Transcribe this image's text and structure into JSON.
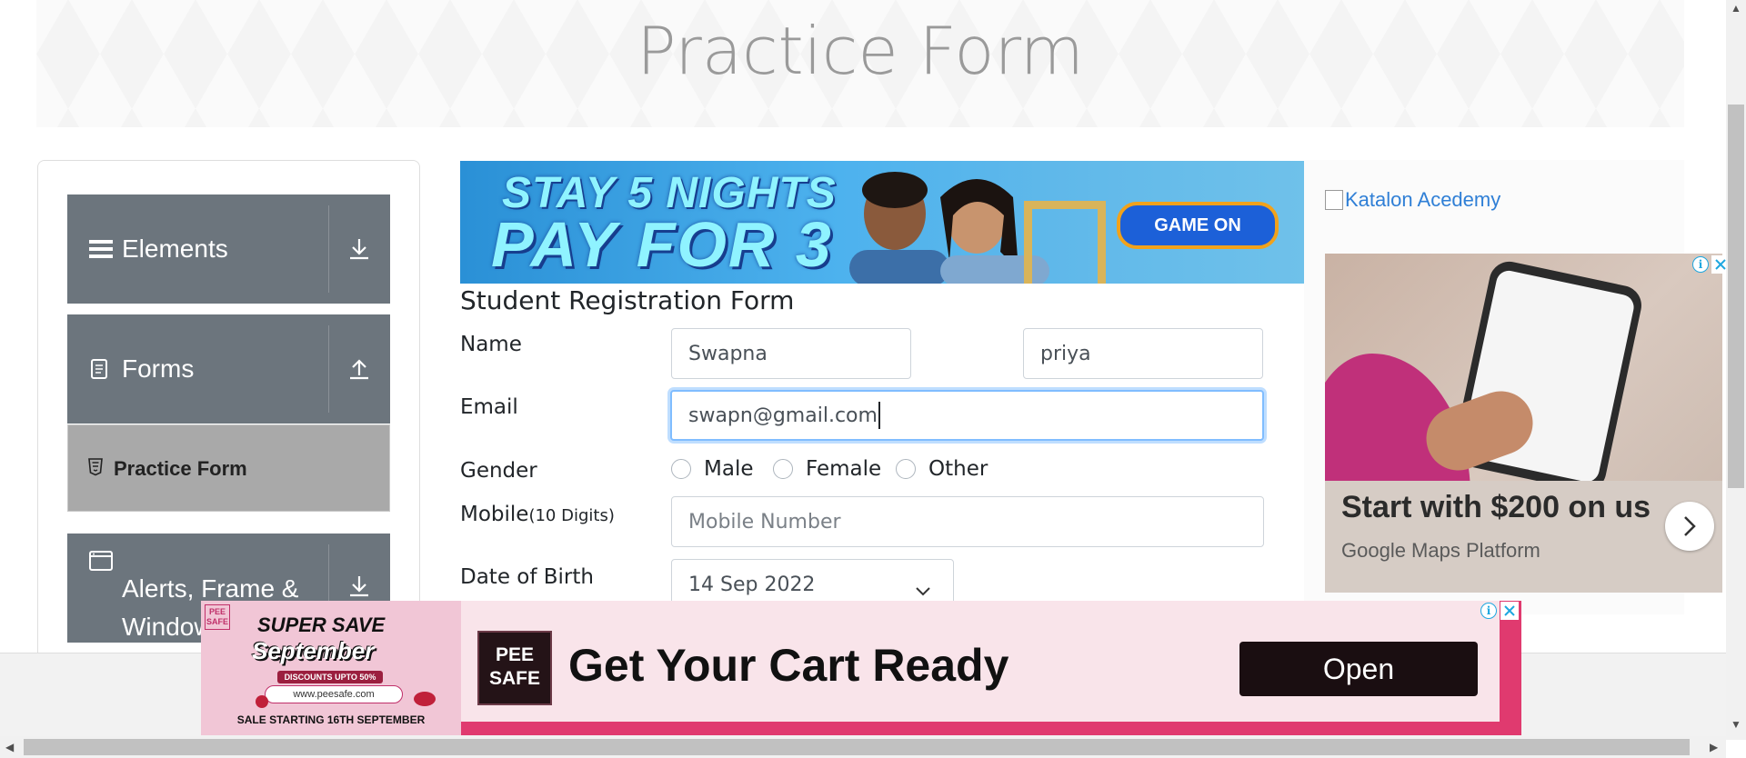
{
  "header": {
    "title": "Practice Form"
  },
  "sidebar": {
    "groups": [
      {
        "label": "Elements",
        "icon": "hamburger-icon",
        "arrow": "download-arrow-icon"
      },
      {
        "label": "Forms",
        "icon": "document-icon",
        "arrow": "upload-arrow-icon"
      },
      {
        "label": "Alerts, Frame & Windows",
        "icon": "window-icon",
        "arrow": "download-arrow-icon"
      }
    ],
    "active_item": {
      "label": "Practice Form",
      "icon": "html5-icon"
    }
  },
  "banner": {
    "line1": "STAY 5 NIGHTS",
    "line2": "PAY FOR 3",
    "button": "GAME ON"
  },
  "form": {
    "title": "Student Registration Form",
    "name_label": "Name",
    "first_name": "Swapna",
    "last_name": "priya",
    "email_label": "Email",
    "email_value": "swapn@gmail.com",
    "gender_label": "Gender",
    "gender_options": [
      "Male",
      "Female",
      "Other"
    ],
    "mobile_label": "Mobile",
    "mobile_hint": "(10 Digits)",
    "mobile_placeholder": "Mobile Number",
    "dob_label": "Date of Birth",
    "dob_value": "14 Sep 2022"
  },
  "right_ad": {
    "katalon_link": "Katalon Acedemy",
    "headline": "Start with $200 on us",
    "sub": "Google Maps Platform"
  },
  "bottom_ad": {
    "brand_mini": "PEE SAFE",
    "promo_line1": "SUPER SAVE",
    "promo_line2": "September",
    "promo_discount": "DISCOUNTS UPTO 50%",
    "promo_url": "www.peesafe.com",
    "promo_start": "SALE STARTING 16TH SEPTEMBER",
    "logo_line1": "PEE",
    "logo_line2": "SAFE",
    "cta_text": "Get Your Cart Ready",
    "button": "Open"
  },
  "colors": {
    "sidebar_bg": "#6c757d",
    "active_item_bg": "#a9a9a9",
    "focus_border": "#80bdff",
    "ad_pink": "#e03a6f",
    "link_blue": "#2f7fd6"
  }
}
